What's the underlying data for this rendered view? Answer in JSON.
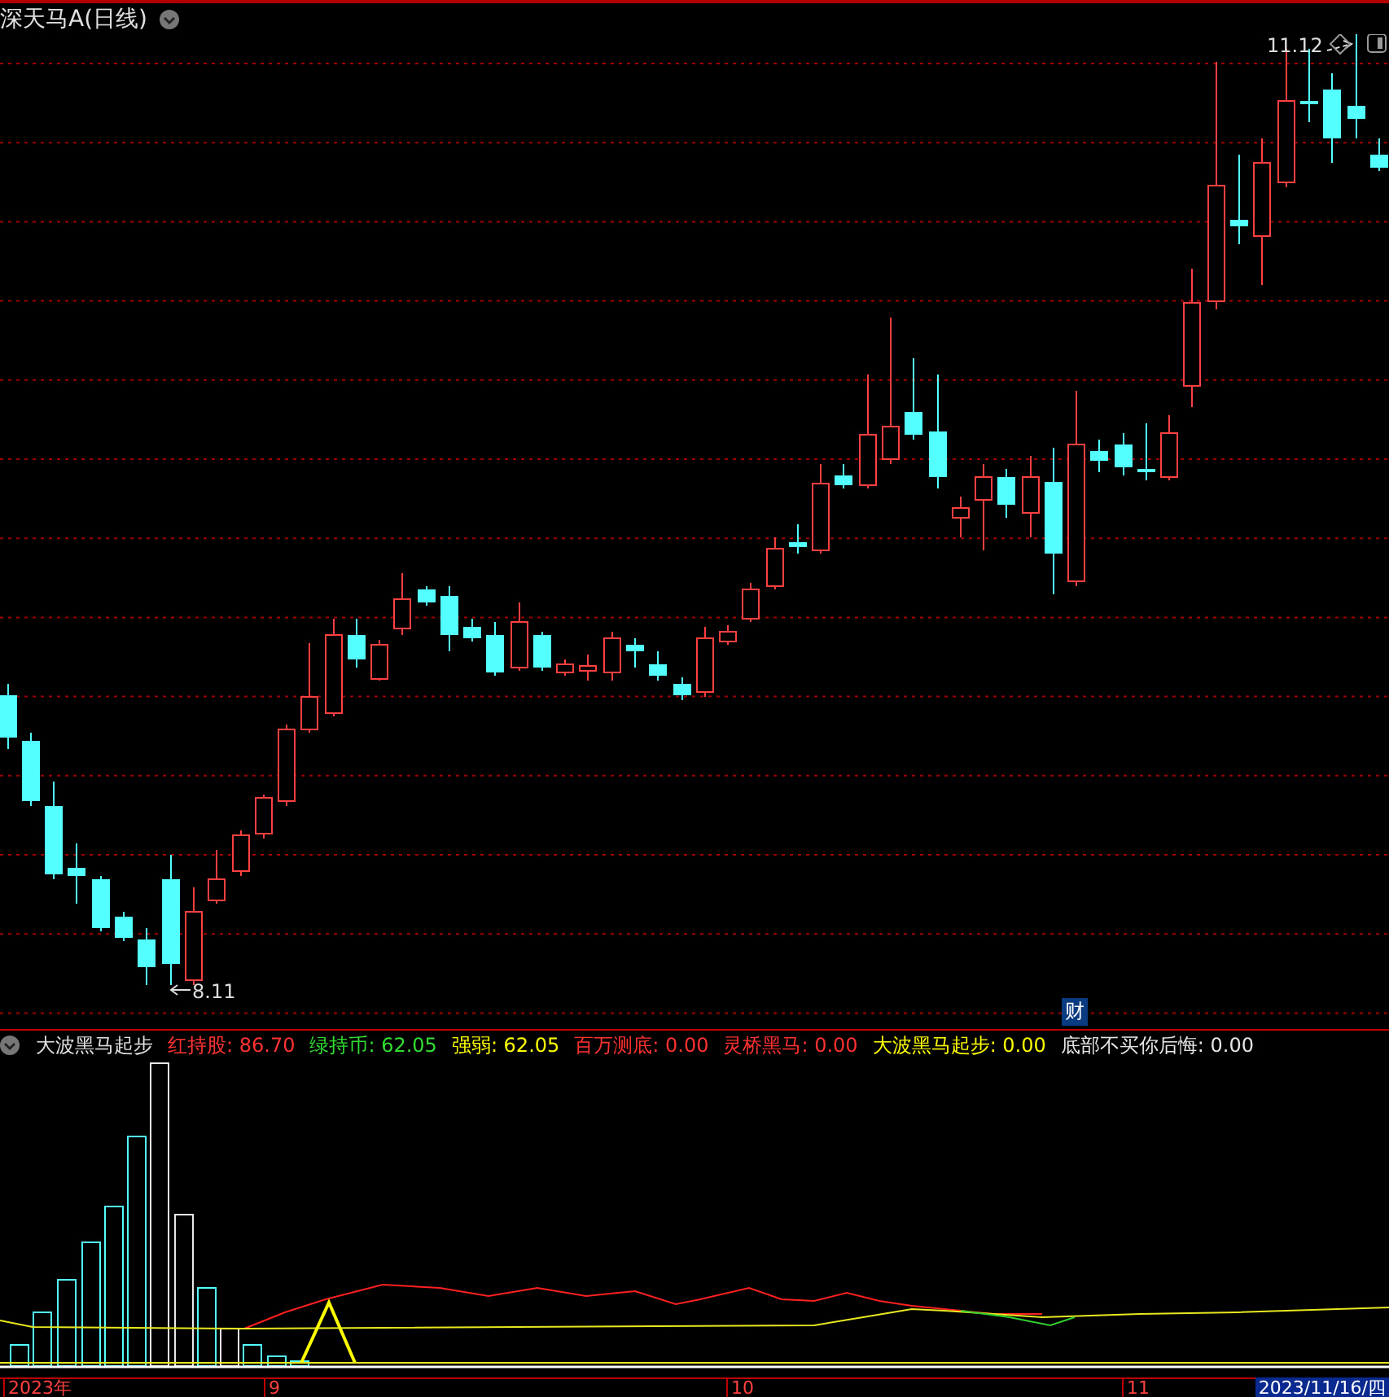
{
  "title": {
    "label": "深天马A(日线)"
  },
  "price_chart": {
    "high_label": "11.12",
    "low_label": "8.11",
    "marker": "财"
  },
  "indicator": {
    "name": "大波黑马起步",
    "legend": [
      {
        "label": "红持股:",
        "value": "86.70",
        "color": "#ff3232"
      },
      {
        "label": "绿持币:",
        "value": "62.05",
        "color": "#33dd33"
      },
      {
        "label": "强弱:",
        "value": "62.05",
        "color": "#ffff00"
      },
      {
        "label": "百万测底:",
        "value": "0.00",
        "color": "#ff3232"
      },
      {
        "label": "灵桥黑马:",
        "value": "0.00",
        "color": "#ff3232"
      },
      {
        "label": "大波黑马起步:",
        "value": "0.00",
        "color": "#ffff00"
      },
      {
        "label": "底部不买你后悔:",
        "value": "0.00",
        "color": "#e6e6e6"
      }
    ]
  },
  "time_axis": {
    "labels": [
      "2023年",
      "9",
      "10",
      "11"
    ],
    "current_date": "2023/11/16/四"
  }
}
